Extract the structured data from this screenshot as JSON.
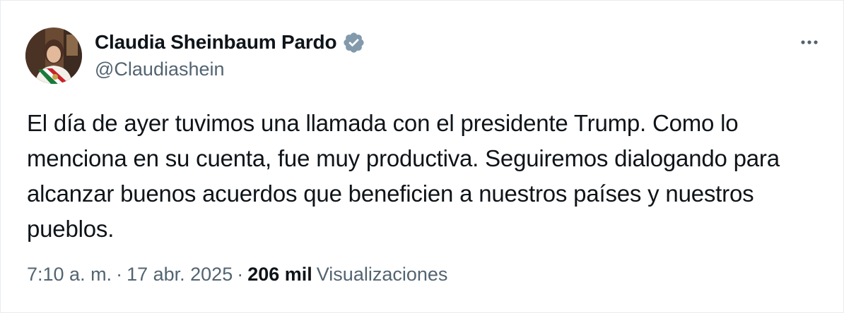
{
  "author": {
    "display_name": "Claudia Sheinbaum Pardo",
    "handle": "@Claudiashein",
    "verified_icon": "verified-badge-icon",
    "verified_color": "#829aab"
  },
  "menu": {
    "icon": "more-horizontal-icon"
  },
  "tweet": {
    "text": "El día de ayer tuvimos una llamada con el presidente Trump. Como lo menciona en su cuenta, fue muy productiva. Seguiremos dialogando para alcanzar buenos acuerdos que beneficien a nuestros países y nuestros pueblos."
  },
  "meta": {
    "time": "7:10 a. m.",
    "separator": "·",
    "date": "17 abr. 2025",
    "views_count": "206 mil",
    "views_label": "Visualizaciones"
  },
  "colors": {
    "text_primary": "#0f1419",
    "text_secondary": "#536471",
    "border": "#e6ecf0"
  }
}
